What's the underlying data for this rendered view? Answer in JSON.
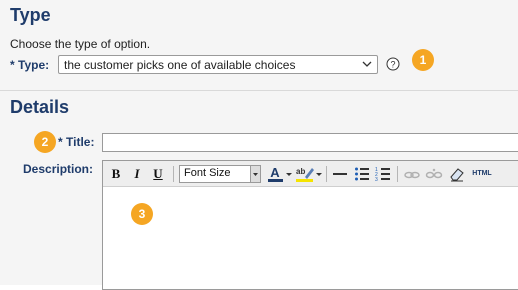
{
  "type_section": {
    "heading": "Type",
    "description": "Choose the type of option.",
    "label": "* Type:",
    "select_value": "the customer picks one of available choices",
    "help_icon": "question-circle-icon",
    "badge": "1"
  },
  "details_section": {
    "heading": "Details",
    "title_badge": "2",
    "title_label": "* Title:",
    "title_value": "",
    "description_label": "Description:",
    "editor_badge": "3",
    "toolbar": {
      "bold": "B",
      "italic": "I",
      "underline": "U",
      "font_size_label": "Font Size",
      "html_label": "HTML"
    }
  },
  "colors": {
    "heading": "#1f3c6b",
    "badge": "#f5a623",
    "panel_bg": "#f5f5f5"
  }
}
